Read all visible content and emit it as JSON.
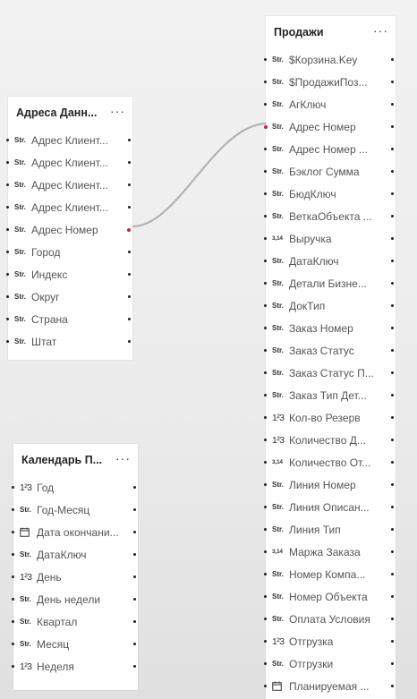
{
  "tables": [
    {
      "title": "Адреса Данн...",
      "fields": [
        {
          "type": "text",
          "name": "Адрес Клиент..."
        },
        {
          "type": "text",
          "name": "Адрес Клиент..."
        },
        {
          "type": "text",
          "name": "Адрес Клиент..."
        },
        {
          "type": "text",
          "name": "Адрес Клиент..."
        },
        {
          "type": "text",
          "name": "Адрес Номер"
        },
        {
          "type": "text",
          "name": "Город"
        },
        {
          "type": "text",
          "name": "Индекс"
        },
        {
          "type": "text",
          "name": "Округ"
        },
        {
          "type": "text",
          "name": "Страна"
        },
        {
          "type": "text",
          "name": "Штат"
        }
      ]
    },
    {
      "title": "Продажи",
      "fields": [
        {
          "type": "text",
          "name": "$Корзина.Key"
        },
        {
          "type": "text",
          "name": "$ПродажиПоз..."
        },
        {
          "type": "text",
          "name": "АгКлюч"
        },
        {
          "type": "text",
          "name": "Адрес Номер"
        },
        {
          "type": "text",
          "name": "Адрес Номер ..."
        },
        {
          "type": "text",
          "name": "Бэклог Сумма"
        },
        {
          "type": "text",
          "name": "БюдКлюч"
        },
        {
          "type": "text",
          "name": "ВеткаОбъекта ..."
        },
        {
          "type": "decimal",
          "name": "Выручка"
        },
        {
          "type": "text",
          "name": "ДатаКлюч"
        },
        {
          "type": "text",
          "name": "Детали Бизне..."
        },
        {
          "type": "text",
          "name": "ДокТип"
        },
        {
          "type": "text",
          "name": "Заказ Номер"
        },
        {
          "type": "text",
          "name": "Заказ Статус"
        },
        {
          "type": "text",
          "name": "Заказ Статус П..."
        },
        {
          "type": "text",
          "name": "Заказ Тип Дет..."
        },
        {
          "type": "integer",
          "name": "Кол-во Резерв"
        },
        {
          "type": "integer",
          "name": "Количество Д..."
        },
        {
          "type": "decimal",
          "name": "Количество От..."
        },
        {
          "type": "text",
          "name": "Линия Номер"
        },
        {
          "type": "text",
          "name": "Линия Описан..."
        },
        {
          "type": "text",
          "name": "Линия Тип"
        },
        {
          "type": "decimal",
          "name": "Маржа Заказа"
        },
        {
          "type": "text",
          "name": "Номер Компа..."
        },
        {
          "type": "text",
          "name": "Номер Объекта"
        },
        {
          "type": "text",
          "name": "Оплата Условия"
        },
        {
          "type": "integer",
          "name": "Отгрузка"
        },
        {
          "type": "text",
          "name": "Отгрузки"
        },
        {
          "type": "date",
          "name": "Планируемая ..."
        }
      ]
    },
    {
      "title": "Календарь П...",
      "fields": [
        {
          "type": "integer",
          "name": "Год"
        },
        {
          "type": "text",
          "name": "Год-Месяц"
        },
        {
          "type": "date",
          "name": "Дата окончани..."
        },
        {
          "type": "text",
          "name": "ДатаКлюч"
        },
        {
          "type": "integer",
          "name": "День"
        },
        {
          "type": "text",
          "name": "День недели"
        },
        {
          "type": "text",
          "name": "Квартал"
        },
        {
          "type": "text",
          "name": "Месяц"
        },
        {
          "type": "integer",
          "name": "Неделя"
        }
      ]
    }
  ],
  "type_icons": {
    "text": "Str.",
    "decimal": "3,14",
    "integer": "1²3",
    "date": "calendar-icon"
  },
  "more_label": "···",
  "relationship": {
    "from_table": "Адреса Данн...",
    "from_field": "Адрес Номер",
    "to_table": "Продажи",
    "to_field": "Адрес Номер"
  },
  "colors": {
    "key_dot": "#c5283d",
    "connector": "#b3b3b3"
  }
}
